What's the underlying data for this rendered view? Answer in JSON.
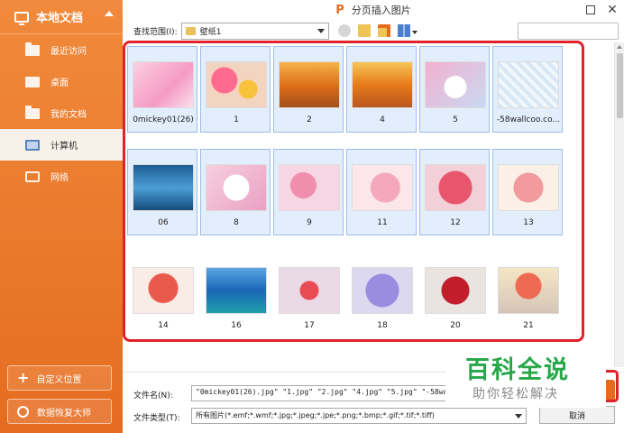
{
  "window": {
    "title": "分页插入图片",
    "logo": "P"
  },
  "sidebar": {
    "header": "本地文档",
    "items": [
      {
        "label": "最近访问",
        "icon": "recent-folder-icon"
      },
      {
        "label": "桌面",
        "icon": "desktop-icon"
      },
      {
        "label": "我的文档",
        "icon": "documents-folder-icon"
      },
      {
        "label": "计算机",
        "icon": "computer-icon",
        "active": true
      },
      {
        "label": "网络",
        "icon": "network-icon"
      }
    ],
    "custom_location": "自定义位置",
    "data_recovery": "数据恢复大师"
  },
  "toolbar": {
    "lookin_label": "查找范围(I):",
    "current_folder": "壁纸1",
    "search_placeholder": ""
  },
  "files": [
    {
      "name": "0mickey01(26)",
      "selected": true
    },
    {
      "name": "1",
      "selected": true
    },
    {
      "name": "2",
      "selected": true
    },
    {
      "name": "4",
      "selected": true
    },
    {
      "name": "5",
      "selected": true
    },
    {
      "name": "-58wallcoo.co...",
      "selected": true
    },
    {
      "name": "06",
      "selected": true
    },
    {
      "name": "8",
      "selected": true
    },
    {
      "name": "9",
      "selected": true
    },
    {
      "name": "11",
      "selected": true
    },
    {
      "name": "12",
      "selected": true
    },
    {
      "name": "13",
      "selected": true
    },
    {
      "name": "14",
      "selected": false
    },
    {
      "name": "16",
      "selected": false
    },
    {
      "name": "17",
      "selected": false
    },
    {
      "name": "18",
      "selected": false
    },
    {
      "name": "20",
      "selected": false
    },
    {
      "name": "21",
      "selected": false
    }
  ],
  "bottom": {
    "filename_label": "文件名(N):",
    "filename_value": "\"0mickey01(26).jpg\" \"1.jpg\" \"2.jpg\" \"4.jpg\" \"5.jpg\" \"-58wallc",
    "filetype_label": "文件类型(T):",
    "filetype_value": "所有图片(*.emf;*.wmf;*.jpg;*.jpeg;*.jpe;*.png;*.bmp;*.gif;*.tif;*.tiff)",
    "cancel_label": "取消"
  },
  "watermark": {
    "main": "百科全说",
    "sub": "助你轻松解决"
  },
  "colors": {
    "sidebar_orange": "#e56c1f",
    "selection_fill": "#e2eefc",
    "selection_border": "#9dbde9",
    "highlight_red": "#e0222b",
    "watermark_green": "#27a749"
  }
}
